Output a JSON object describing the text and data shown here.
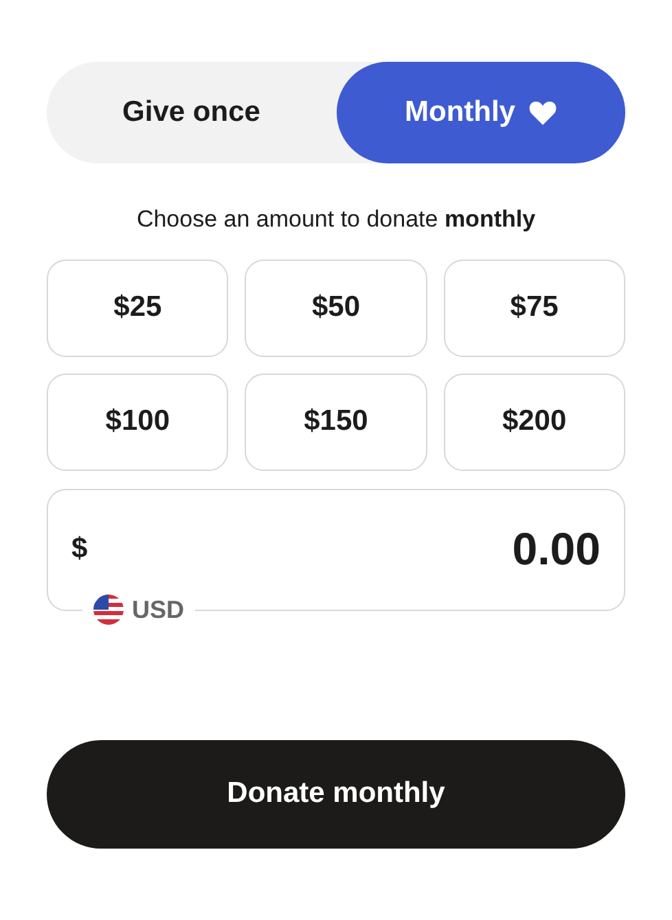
{
  "frequency_tabs": [
    {
      "label": "Give once",
      "selected": false,
      "heart": false
    },
    {
      "label": "Monthly",
      "selected": true,
      "heart": true
    }
  ],
  "prompt": "Choose an amount to donate **monthly**",
  "amounts": [
    {
      "label": "$25",
      "selected": false
    },
    {
      "label": "$50",
      "selected": false
    },
    {
      "label": "$75",
      "selected": false
    },
    {
      "label": "$100",
      "selected": false
    },
    {
      "label": "$150",
      "selected": false
    },
    {
      "label": "$200",
      "selected": false
    }
  ],
  "amount_field": {
    "symbol": "$",
    "value": "0.00",
    "currency": "USD"
  },
  "donate_button": "Donate monthly"
}
